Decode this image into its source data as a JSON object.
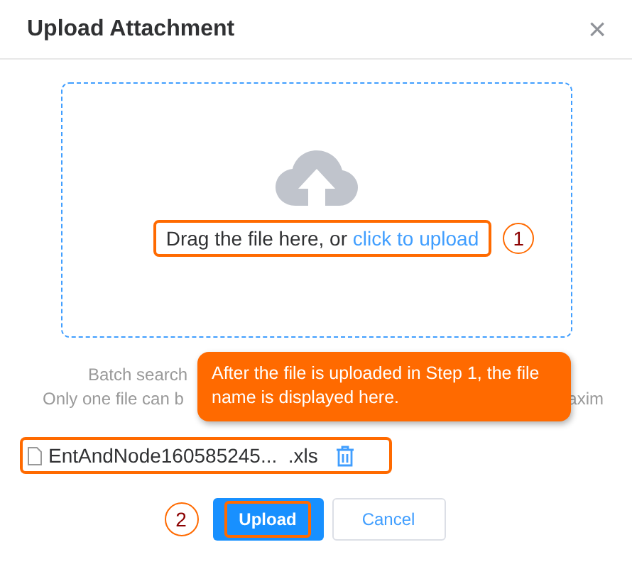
{
  "dialog": {
    "title": "Upload Attachment",
    "close": "×"
  },
  "drop_zone": {
    "text": "Drag the file here, or ",
    "link": "click to upload",
    "step": "1"
  },
  "hint": {
    "line_1": "Batch search",
    "line_2_start": "Only one file can b",
    "line_2_end": "axim"
  },
  "callout": {
    "text": "After the file is uploaded in Step 1, the file name is displayed here."
  },
  "file": {
    "name": "EntAndNode160585245...  .xls"
  },
  "buttons": [
    {
      "label": "Upload",
      "kind": "primary",
      "step": "2"
    },
    {
      "label": "Cancel",
      "kind": "default"
    }
  ]
}
